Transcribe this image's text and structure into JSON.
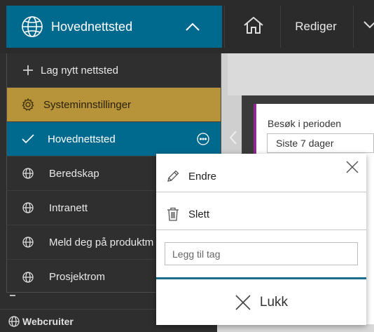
{
  "topbar": {
    "site_title": "Hovednettsted",
    "edit_label": "Rediger",
    "icons": {
      "site": "globe-icon",
      "toggle": "chevron-up-icon",
      "home": "home-icon",
      "more": "chevron-down-icon"
    }
  },
  "dropdown": {
    "new_site_label": "Lag nytt nettsted",
    "system_settings_label": "Systeminnstillinger",
    "current_site_label": "Hovednettsted",
    "sites": [
      {
        "label": "Beredskap",
        "icon": "globe-icon"
      },
      {
        "label": "Intranett",
        "icon": "globe-icon"
      },
      {
        "label": "Meld deg på produktm",
        "icon": "globe-icon"
      },
      {
        "label": "Prosjektrom",
        "icon": "globe-icon"
      }
    ]
  },
  "sidebar_below": {
    "webcruiter_label": "Webcruiter"
  },
  "content": {
    "visits_label": "Besøk i perioden",
    "period_value": "Siste 7 dager"
  },
  "popup": {
    "edit_label": "Endre",
    "delete_label": "Slett",
    "tag_placeholder": "Legg til tag",
    "close_label": "Lukk"
  },
  "colors": {
    "brand_blue": "#006a8e",
    "system_gold": "#b7933a",
    "accent_purple": "#8e2a8e",
    "dark_bg": "#2e2e2e"
  }
}
